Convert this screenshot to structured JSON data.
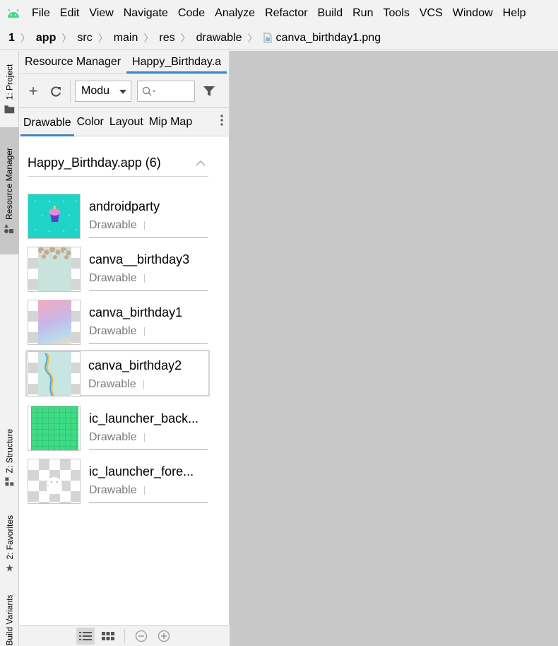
{
  "menu": {
    "items": [
      "File",
      "Edit",
      "View",
      "Navigate",
      "Code",
      "Analyze",
      "Refactor",
      "Build",
      "Run",
      "Tools",
      "VCS",
      "Window",
      "Help"
    ]
  },
  "breadcrumb": {
    "project_num": "1",
    "items": [
      "app",
      "src",
      "main",
      "res",
      "drawable",
      "canva_birthday1.png"
    ]
  },
  "toolstrip": {
    "project_label": "1: Project",
    "resource_manager_label": "Resource Manager",
    "structure_label": "Z: Structure",
    "favorites_label": "2: Favorites",
    "build_variants_label": "Build Variants"
  },
  "panel": {
    "tabs": [
      "Resource Manager",
      "Happy_Birthday.a"
    ],
    "module_select": "Modu",
    "type_tabs": [
      "Drawable",
      "Color",
      "Layout",
      "Mip Map"
    ],
    "group_title": "Happy_Birthday.app (6)",
    "resources": [
      {
        "name": "androidparty",
        "type": "Drawable"
      },
      {
        "name": "canva__birthday3",
        "type": "Drawable"
      },
      {
        "name": "canva_birthday1",
        "type": "Drawable"
      },
      {
        "name": "canva_birthday2",
        "type": "Drawable"
      },
      {
        "name": "ic_launcher_back...",
        "type": "Drawable"
      },
      {
        "name": "ic_launcher_fore...",
        "type": "Drawable"
      }
    ]
  },
  "colors": {
    "accent": "#4083c9",
    "editor_bg": "#c8c8c8",
    "android_green": "#3ddc84"
  }
}
